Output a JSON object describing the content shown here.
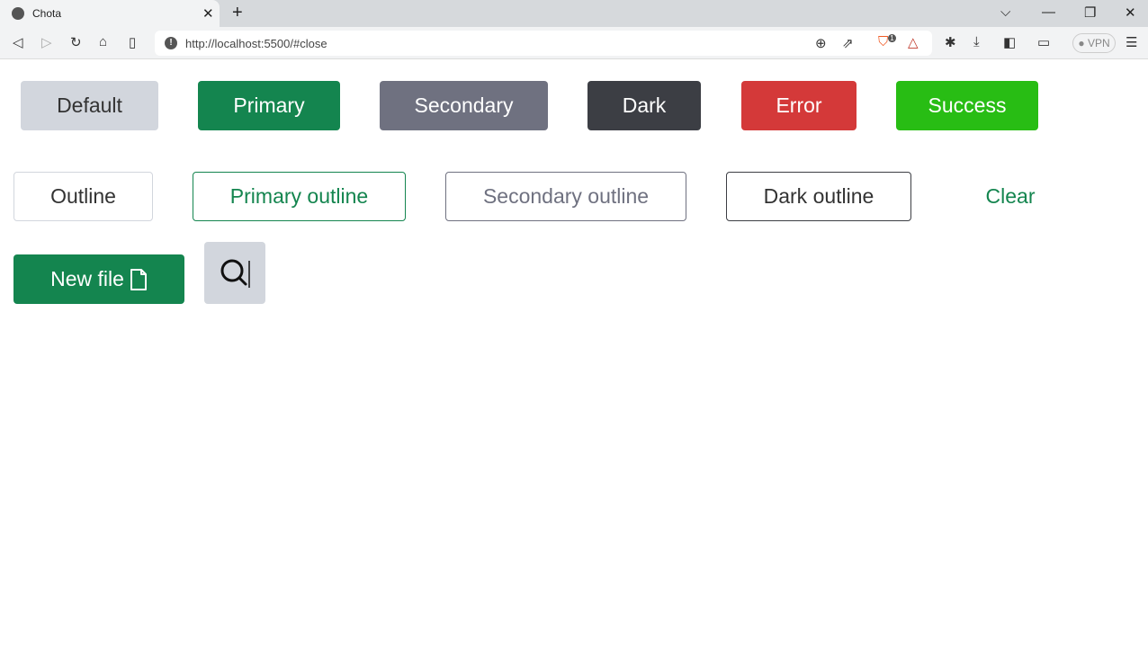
{
  "browser": {
    "tab_title": "Chota",
    "url": "http://localhost:5500/#close",
    "vpn_label": "VPN",
    "shields_badge": "1"
  },
  "buttons_row1": [
    {
      "label": "Default",
      "bg": "#d2d6dd",
      "color": "#333333"
    },
    {
      "label": "Primary",
      "bg": "#14854f",
      "color": "#ffffff"
    },
    {
      "label": "Secondary",
      "bg": "#6f7180",
      "color": "#ffffff"
    },
    {
      "label": "Dark",
      "bg": "#3c3e44",
      "color": "#ffffff"
    },
    {
      "label": "Error",
      "bg": "#d43939",
      "color": "#ffffff"
    },
    {
      "label": "Success",
      "bg": "#28bd14",
      "color": "#ffffff"
    }
  ],
  "buttons_row2": [
    {
      "label": "Outline",
      "border": "#d2d6dd",
      "color": "#333333"
    },
    {
      "label": "Primary outline",
      "border": "#14854f",
      "color": "#14854f"
    },
    {
      "label": "Secondary outline",
      "border": "#6f7180",
      "color": "#6f7180"
    },
    {
      "label": "Dark outline",
      "border": "#3c3e44",
      "color": "#333333"
    },
    {
      "label": "Clear",
      "border": "transparent",
      "color": "#14854f"
    }
  ],
  "new_file": {
    "label": "New file",
    "icon": "file-icon"
  },
  "search_button": {
    "icon": "search-icon"
  }
}
